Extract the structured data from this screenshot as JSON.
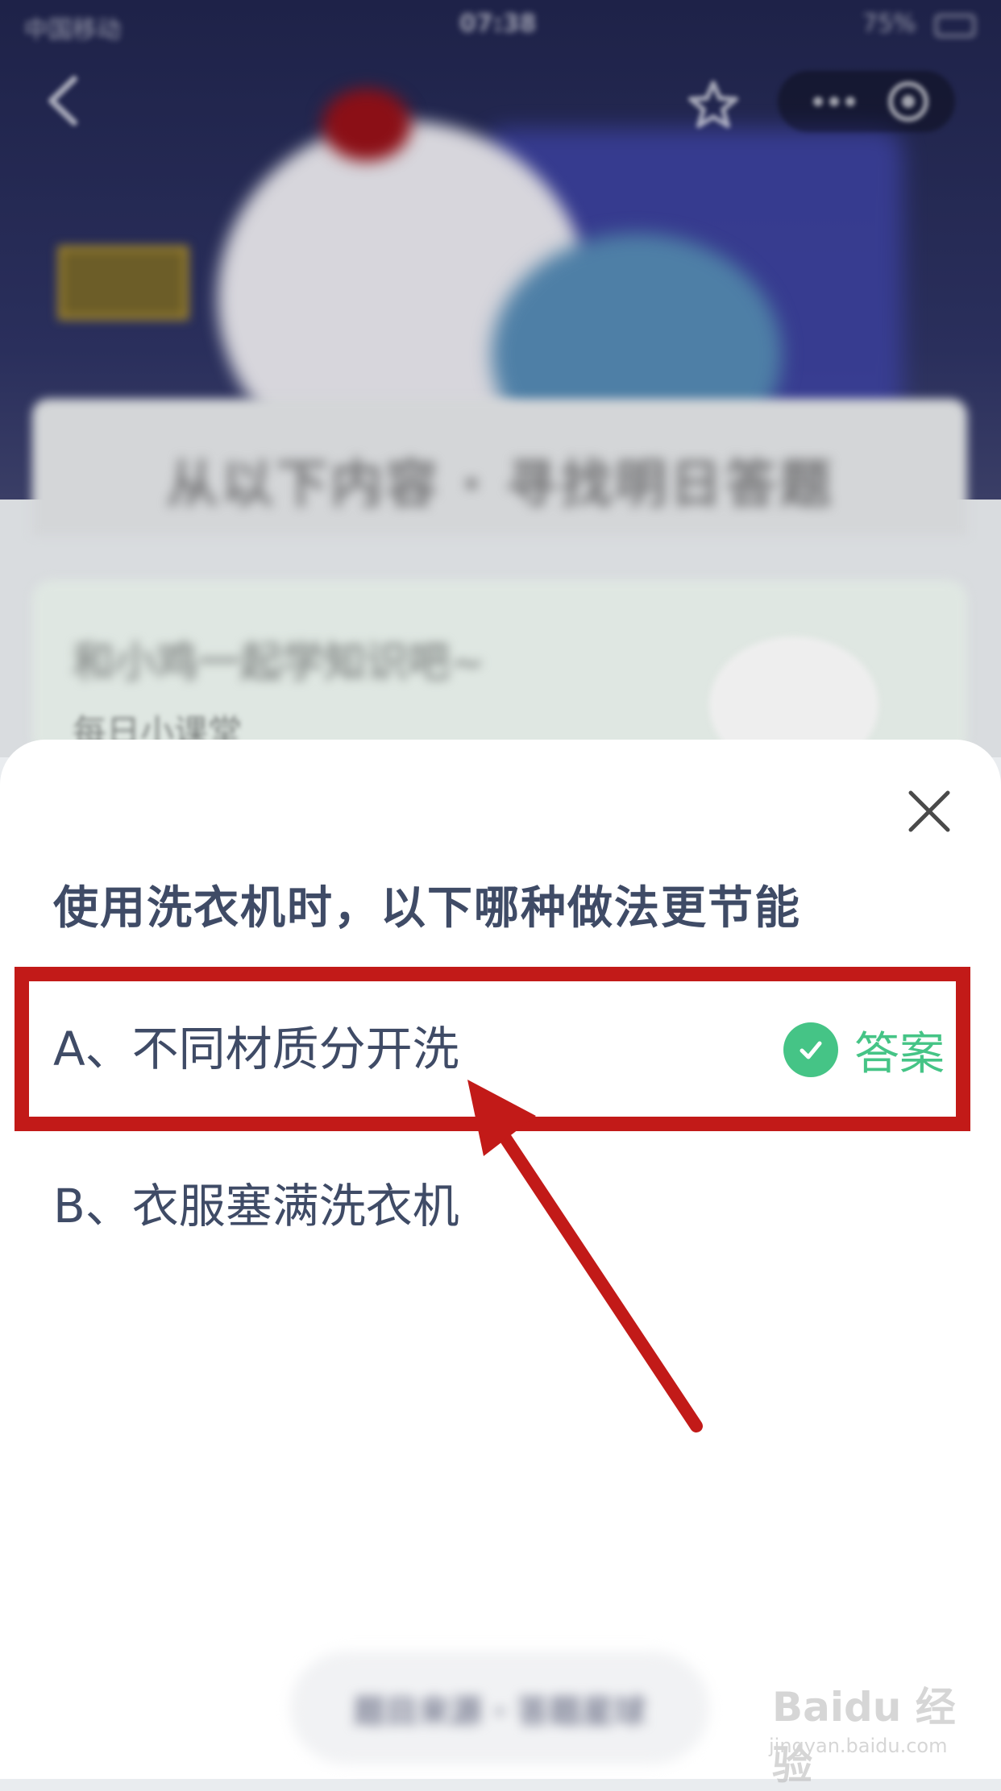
{
  "status_bar": {
    "carrier": "中国移动",
    "time": "07:38",
    "battery": "75%"
  },
  "background": {
    "card_title": "从以下内容 · 寻找明日答题",
    "card2_title": "和小鸡一起学知识吧~",
    "card2_subtitle": "每日小课堂"
  },
  "sheet": {
    "question": "使用洗衣机时，以下哪种做法更节能",
    "options": [
      {
        "label": "A、不同材质分开洗",
        "is_answer": true
      },
      {
        "label": "B、衣服塞满洗衣机",
        "is_answer": false
      }
    ],
    "answer_label": "答案",
    "bottom_button": "题目来源 · 答题星球"
  },
  "watermark": {
    "brand": "Baidu 经验",
    "site": "jingyan.baidu.com"
  },
  "colors": {
    "answer_green": "#45c486",
    "annotation_red": "#c21a18",
    "text_primary": "#3f4b66"
  },
  "icons": [
    "back-icon",
    "star-icon",
    "more-icon",
    "target-icon",
    "close-icon",
    "check-icon"
  ]
}
